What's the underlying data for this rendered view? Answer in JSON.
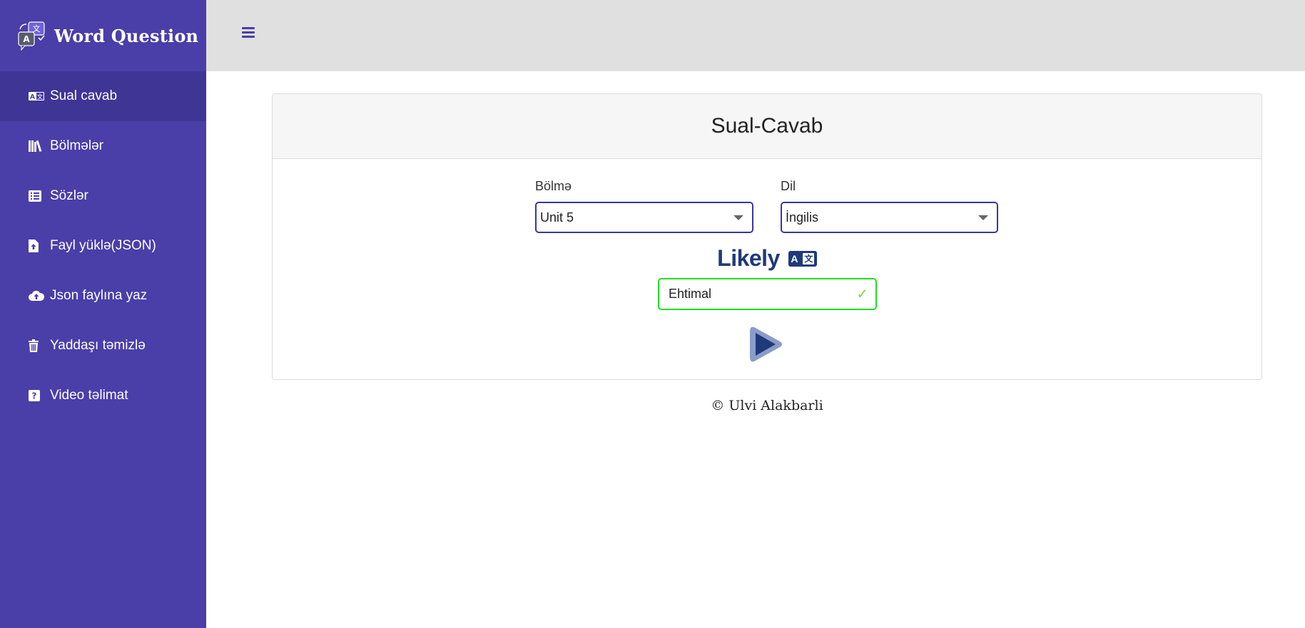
{
  "brand": {
    "title": "Word Question",
    "logo_icon": "translate-chat-icon"
  },
  "sidebar": {
    "items": [
      {
        "label": "Sual cavab",
        "icon": "translate-icon",
        "active": true
      },
      {
        "label": "Bölmələr",
        "icon": "books-icon",
        "active": false
      },
      {
        "label": "Sözlər",
        "icon": "list-icon",
        "active": false
      },
      {
        "label": "Fayl yüklə(JSON)",
        "icon": "file-upload-icon",
        "active": false
      },
      {
        "label": "Json faylına yaz",
        "icon": "cloud-upload-icon",
        "active": false
      },
      {
        "label": "Yaddaşı təmizlə",
        "icon": "trash-icon",
        "active": false
      },
      {
        "label": "Video təlimat",
        "icon": "question-icon",
        "active": false
      }
    ]
  },
  "topbar": {
    "menu_icon": "hamburger-icon"
  },
  "card": {
    "title": "Sual-Cavab",
    "section": {
      "label": "Bölmə",
      "value": "Unit 5"
    },
    "language": {
      "label": "Dil",
      "value": "İngilis"
    },
    "word": "Likely",
    "answer": "Ehtimal",
    "translate_badge": {
      "left": "A",
      "right": "文"
    }
  },
  "footer": {
    "text": "© Ulvi Alakbarli"
  },
  "colors": {
    "sidebar_bg": "#4a3ea8",
    "sidebar_active": "#3f3595",
    "topbar_bg": "#e0e0e0",
    "word_color": "#1e3a7a",
    "answer_border": "#22dd22",
    "select_border": "#3a35a0"
  }
}
